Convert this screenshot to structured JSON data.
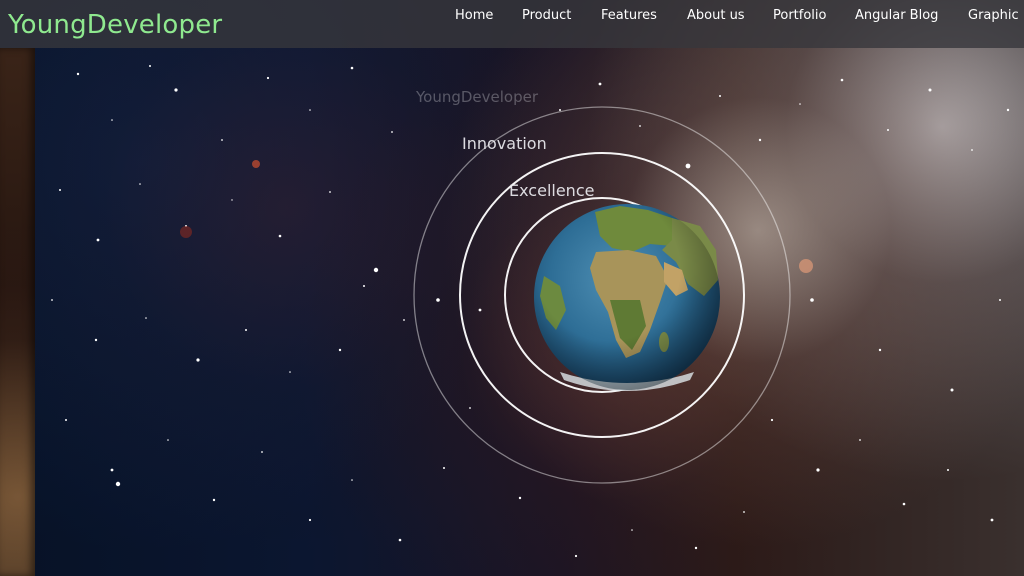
{
  "header": {
    "brand": "YoungDeveloper",
    "nav": [
      {
        "label": "Home"
      },
      {
        "label": "Product"
      },
      {
        "label": "Features"
      },
      {
        "label": "About us"
      },
      {
        "label": "Portfolio"
      },
      {
        "label": "Angular Blog"
      },
      {
        "label": "Graphic"
      }
    ]
  },
  "hero": {
    "orbit_labels": {
      "outer": "YoungDeveloper",
      "middle": "Innovation",
      "inner": "Excellence"
    },
    "center_icon": "earth-globe-icon"
  },
  "colors": {
    "brand": "#8fe98f",
    "header_bg": "#37373c",
    "nav_text": "#ffffff",
    "orbit_ring": "#ffffff"
  }
}
